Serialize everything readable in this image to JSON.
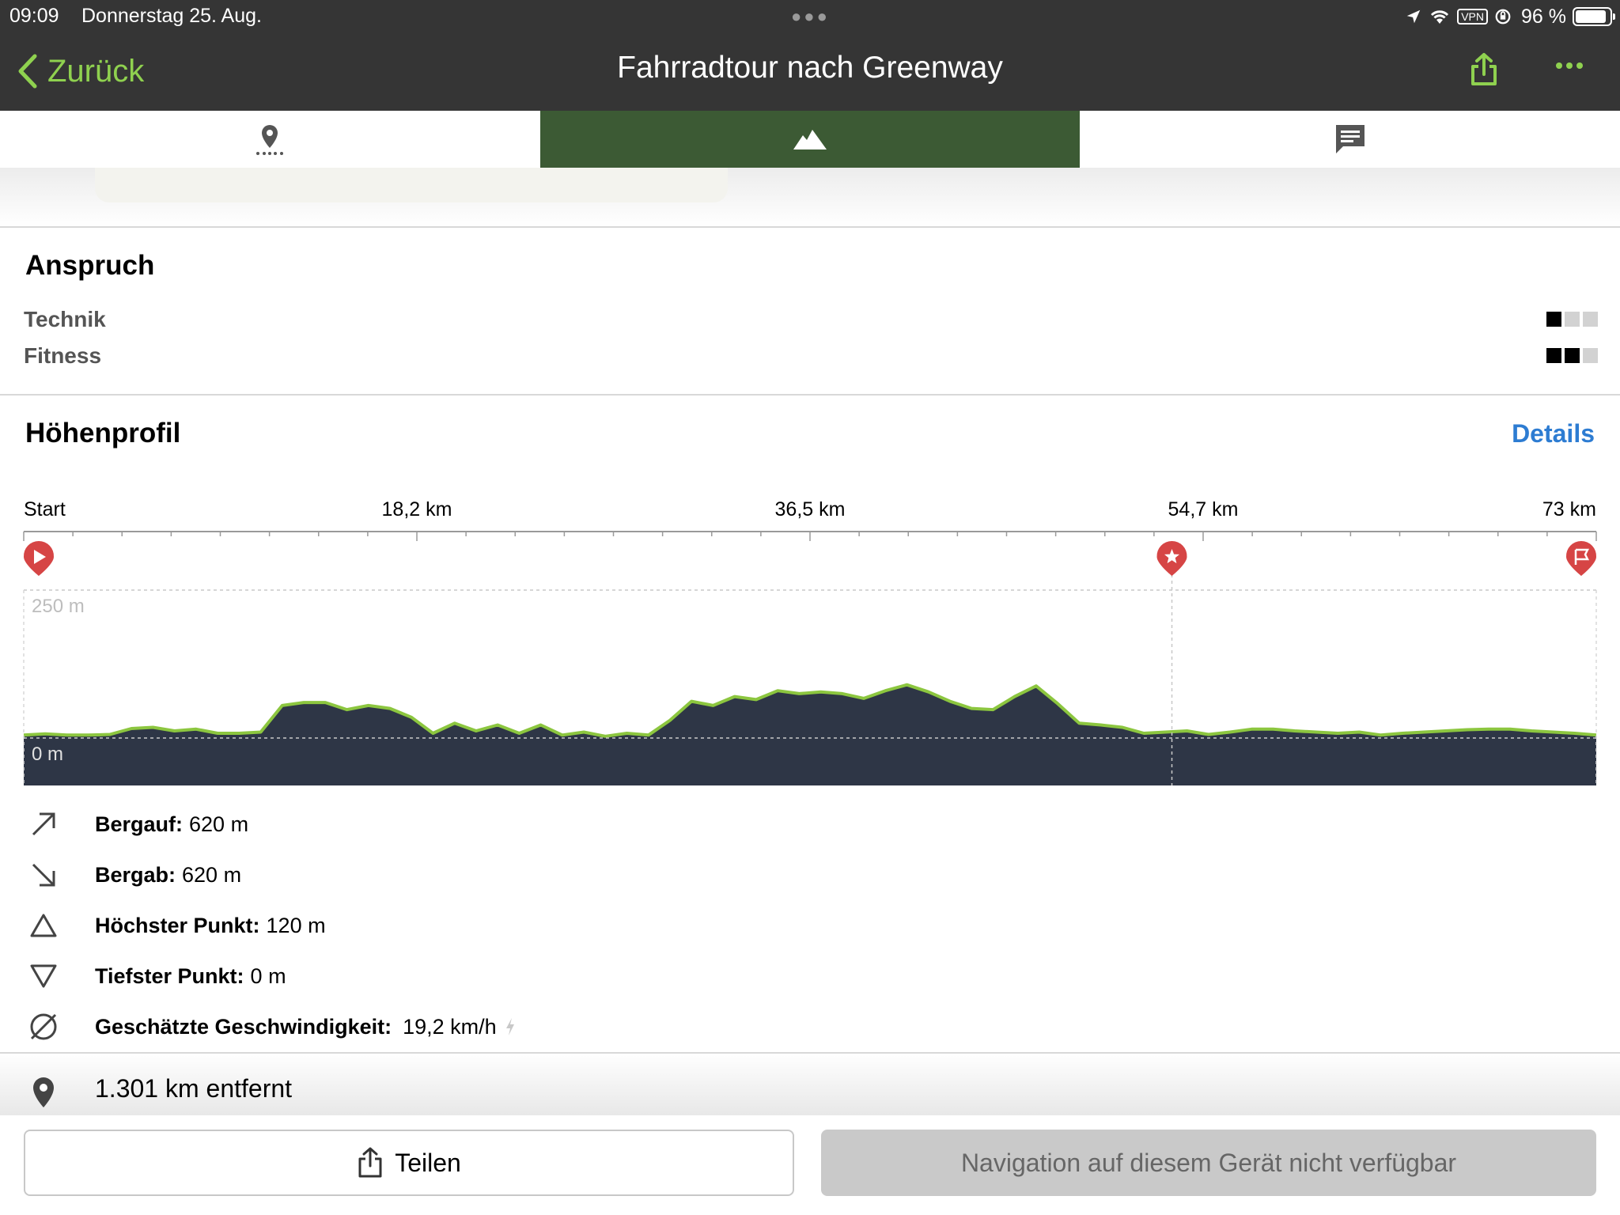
{
  "status_bar": {
    "time": "09:09",
    "date": "Donnerstag 25. Aug.",
    "vpn": "VPN",
    "battery_text": "96 %",
    "battery_level": 0.96
  },
  "nav": {
    "back_label": "Zurück",
    "title": "Fahrradtour nach Greenway",
    "share_icon": "share-icon",
    "more_icon": "more-icon"
  },
  "tabs": [
    {
      "icon": "map-pin-icon",
      "active": false
    },
    {
      "icon": "mountain-icon",
      "active": true
    },
    {
      "icon": "comment-icon",
      "active": false
    }
  ],
  "difficulty": {
    "title": "Anspruch",
    "items": [
      {
        "label": "Technik",
        "level": 1,
        "max": 3
      },
      {
        "label": "Fitness",
        "level": 2,
        "max": 3
      }
    ]
  },
  "elevation": {
    "title": "Höhenprofil",
    "details_label": "Details",
    "chart_data": {
      "type": "area",
      "x_tick_labels": [
        "Start",
        "18,2 km",
        "36,5 km",
        "54,7 km",
        "73 km"
      ],
      "x_unit": "km",
      "y_labels": [
        "250 m",
        "0 m"
      ],
      "ylim": [
        0,
        250
      ],
      "xlim": [
        0,
        73
      ],
      "markers": [
        {
          "type": "start",
          "km": 0
        },
        {
          "type": "waypoint-star",
          "km": 53.3
        },
        {
          "type": "finish-flag",
          "km": 73
        }
      ],
      "series": [
        {
          "x": [
            0,
            1,
            2,
            3,
            4,
            5,
            6,
            7,
            8,
            9,
            10,
            11,
            12,
            13,
            14,
            15,
            16,
            17,
            18,
            19,
            20,
            21,
            22,
            23,
            24,
            25,
            26,
            27,
            28,
            29,
            30,
            31,
            32,
            33,
            34,
            35,
            36,
            37,
            38,
            39,
            40,
            41,
            42,
            43,
            44,
            45,
            46,
            47,
            48,
            49,
            50,
            51,
            52,
            53,
            54,
            55,
            56,
            57,
            58,
            59,
            60,
            61,
            62,
            63,
            64,
            65,
            66,
            67,
            68,
            69,
            70,
            71,
            72,
            73
          ],
          "y": [
            5,
            7,
            5,
            5,
            6,
            16,
            18,
            12,
            15,
            8,
            8,
            10,
            55,
            60,
            60,
            48,
            55,
            50,
            35,
            8,
            25,
            12,
            22,
            8,
            22,
            5,
            10,
            3,
            8,
            5,
            30,
            62,
            55,
            70,
            65,
            80,
            75,
            78,
            75,
            67,
            80,
            90,
            78,
            62,
            50,
            48,
            70,
            88,
            58,
            25,
            22,
            18,
            8,
            10,
            12,
            6,
            10,
            15,
            15,
            12,
            10,
            8,
            10,
            5,
            8,
            10,
            12,
            14,
            15,
            15,
            12,
            10,
            8,
            5
          ],
          "line_color": "#8cc63f",
          "fill_color": "#2e3646"
        }
      ]
    }
  },
  "stats": [
    {
      "icon": "arrow-up-right-icon",
      "label": "Bergauf:",
      "value": "620 m"
    },
    {
      "icon": "arrow-down-right-icon",
      "label": "Bergab:",
      "value": "620 m"
    },
    {
      "icon": "triangle-up-icon",
      "label": "Höchster Punkt:",
      "value": "120 m"
    },
    {
      "icon": "triangle-down-icon",
      "label": "Tiefster Punkt:",
      "value": "0 m"
    },
    {
      "icon": "diameter-icon",
      "label": "Geschätzte Geschwindigkeit:",
      "value": "19,2 km/h"
    }
  ],
  "distance": {
    "icon": "location-pin-icon",
    "text": "1.301 km entfernt"
  },
  "footer": {
    "share_label": "Teilen",
    "navigation_label": "Navigation auf diesem Gerät nicht verfügbar"
  }
}
